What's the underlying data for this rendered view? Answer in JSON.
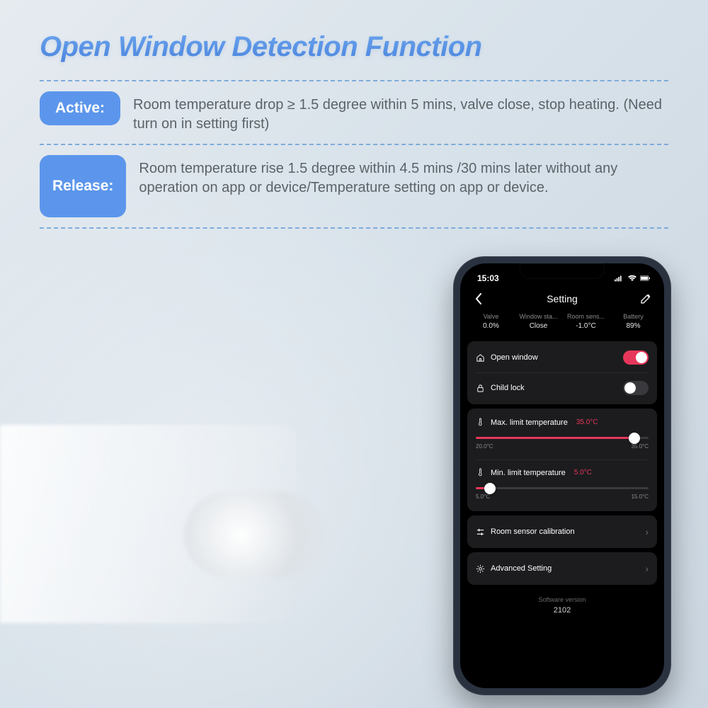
{
  "title": "Open Window Detection Function",
  "rows": {
    "active": {
      "label": "Active:",
      "desc": "Room temperature drop ≥ 1.5 degree within 5 mins, valve close, stop heating. (Need turn on in setting first)"
    },
    "release": {
      "label": "Release:",
      "desc": "Room temperature rise 1.5 degree within 4.5 mins /30 mins later without any operation on app or device/Temperature setting on app or device."
    }
  },
  "phone": {
    "time": "15:03",
    "header": "Setting",
    "stats": {
      "valve": {
        "label": "Valve",
        "value": "0.0%"
      },
      "window": {
        "label": "Window sta...",
        "value": "Close"
      },
      "sensor": {
        "label": "Room sens...",
        "value": "-1.0°C"
      },
      "battery": {
        "label": "Battery",
        "value": "89%"
      }
    },
    "toggles": {
      "openWindow": {
        "label": "Open window",
        "on": true
      },
      "childLock": {
        "label": "Child lock",
        "on": false
      }
    },
    "maxTemp": {
      "label": "Max. limit temperature",
      "value": "35.0°C",
      "min": "20.0°C",
      "max": "35.0°C",
      "pct": 92
    },
    "minTemp": {
      "label": "Min. limit temperature",
      "value": "5.0°C",
      "min": "5.0°C",
      "max": "15.0°C",
      "pct": 8
    },
    "calibration": "Room sensor calibration",
    "advanced": "Advanced Setting",
    "swLabel": "Software version",
    "swVersion": "2102"
  }
}
